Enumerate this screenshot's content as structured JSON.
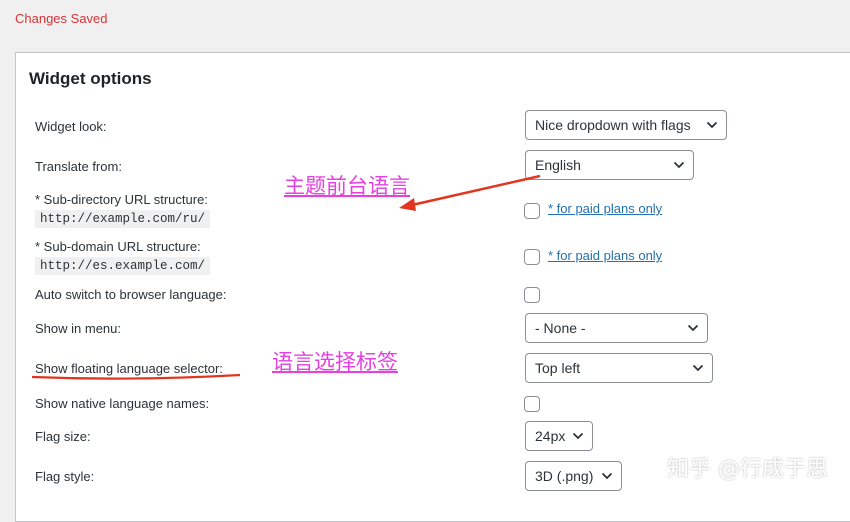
{
  "notice": "Changes Saved",
  "panel_title": "Widget options",
  "rows": {
    "widget_look": {
      "label": "Widget look:",
      "value": "Nice dropdown with flags"
    },
    "translate_from": {
      "label": "Translate from:",
      "value": "English"
    },
    "subdirectory": {
      "label": "* Sub-directory URL structure:",
      "example": "http://example.com/ru/",
      "link": "* for paid plans only"
    },
    "subdomain": {
      "label": "* Sub-domain URL structure:",
      "example": "http://es.example.com/",
      "link": "* for paid plans only"
    },
    "auto_switch": {
      "label": "Auto switch to browser language:"
    },
    "show_in_menu": {
      "label": "Show in menu:",
      "value": "- None -"
    },
    "floating_selector": {
      "label": "Show floating language selector:",
      "value": "Top left"
    },
    "native_names": {
      "label": "Show native language names:"
    },
    "flag_size": {
      "label": "Flag size:",
      "value": "24px"
    },
    "flag_style": {
      "label": "Flag style:",
      "value": "3D (.png)"
    }
  },
  "annotations": {
    "theme_language": "主题前台语言",
    "selector_tag": "语言选择标签",
    "color": "#e63fe3",
    "arrow_color": "#e2351f"
  },
  "watermark": "知乎 @行成于思"
}
